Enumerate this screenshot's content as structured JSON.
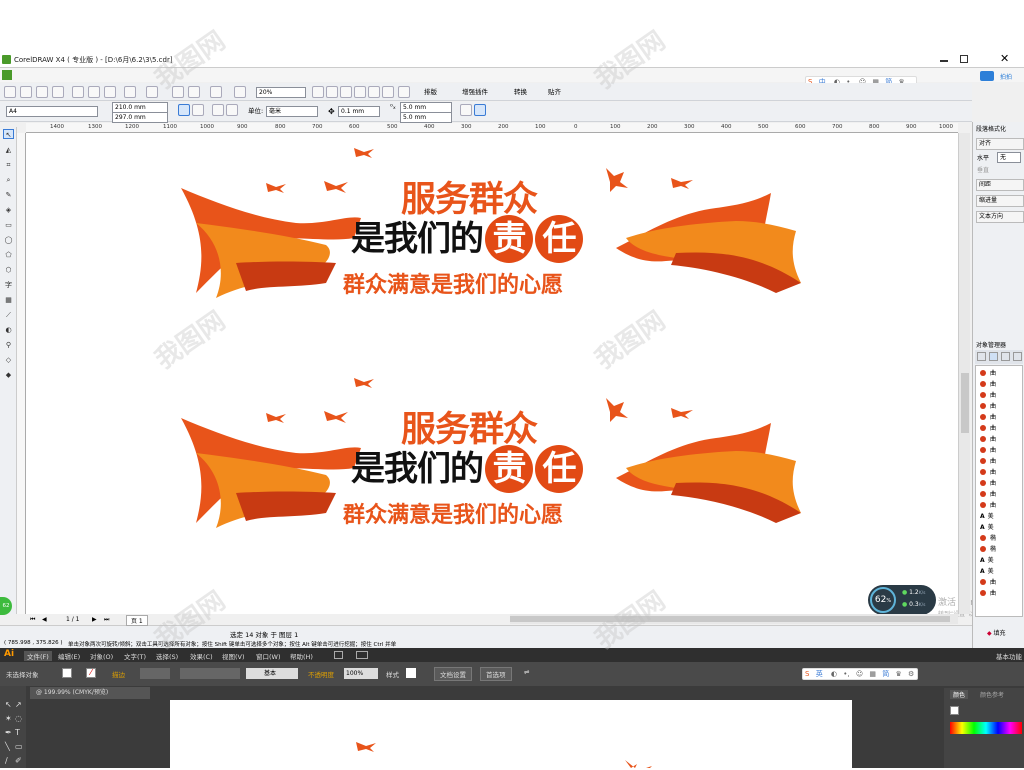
{
  "app": {
    "title": "CorelDRAW X4 ( 专业版 ) - [D:\\6月\\6.2\\3\\5.cdr]",
    "right_link": "拍拍"
  },
  "toolbar": {
    "zoom": "20%",
    "paiban": "排版",
    "plugin": "增强插件",
    "convert": "转换",
    "paste": "贴齐"
  },
  "propbar": {
    "page_size": "A4",
    "width": "210.0 mm",
    "height": "297.0 mm",
    "unit_label": "单位:",
    "unit": "毫米",
    "nudge": "0.1 mm",
    "dup_x": "5.0 mm",
    "dup_y": "5.0 mm"
  },
  "ruler": {
    "ticks": [
      "1400",
      "1300",
      "1200",
      "1100",
      "1000",
      "900",
      "800",
      "700",
      "600",
      "500",
      "400",
      "300",
      "200",
      "100",
      "0",
      "100",
      "200",
      "300",
      "400",
      "500",
      "600",
      "700",
      "800",
      "900",
      "1000"
    ]
  },
  "design": {
    "line1": "服务群众",
    "line2a": "是我们的",
    "char1": "责",
    "char2": "任",
    "line3": "群众满意是我们的心愿"
  },
  "dock": {
    "title": "段落格式化",
    "align": "对齐",
    "horizontal": "水平",
    "horizontal_val": "无",
    "vertical": "垂直",
    "spacing": "间距",
    "indent": "缩进量",
    "direction": "文本方向",
    "obj_manager": "对象管理器",
    "obj_item": "曲",
    "obj_item_b": "美",
    "obj_item_c": "椭"
  },
  "status": {
    "page_info": "1 / 1",
    "page_tab": "页 1",
    "selected": "选定 14 对象 于 图层 1",
    "coords": "( 785.998 , 375.826 )",
    "hint": "单击对象两次可旋转/倾斜；双击工具可选择所有对象；按住 Shift 键单击可选择多个对象；按住 Alt 键单击可进行挖掘；按住 Ctrl 并单",
    "fill": "填充",
    "activate": "激活 Windows",
    "activate_sub": "转到“设置”以激活 Win",
    "speed_pct": "62",
    "speed_unit": "%",
    "up": "1.2",
    "up_unit": "K/s",
    "down": "0.3",
    "down_unit": "K/s",
    "side_badge": "62"
  },
  "ai": {
    "logo": "Ai",
    "menus": [
      "文件(F)",
      "编辑(E)",
      "对象(O)",
      "文字(T)",
      "选择(S)",
      "效果(C)",
      "视图(V)",
      "窗口(W)",
      "帮助(H)"
    ],
    "workspace": "基本功能",
    "no_select": "未选择对象",
    "stroke": "描边",
    "basic": "基本",
    "opacity_label": "不透明度",
    "opacity": "100%",
    "style": "样式",
    "doc_setup": "文档设置",
    "prefs": "首选项",
    "tab": "@ 199.99% (CMYK/预览)",
    "panel_color": "颜色",
    "panel_guide": "颜色参考"
  },
  "ime": {
    "items": [
      "中",
      "简"
    ],
    "items_b": [
      "英",
      "简"
    ]
  },
  "watermark": "我图网",
  "colors": {
    "orange": "#e8541a",
    "orange_light": "#f28a1c",
    "red": "#e24a14",
    "dark": "#111111"
  }
}
